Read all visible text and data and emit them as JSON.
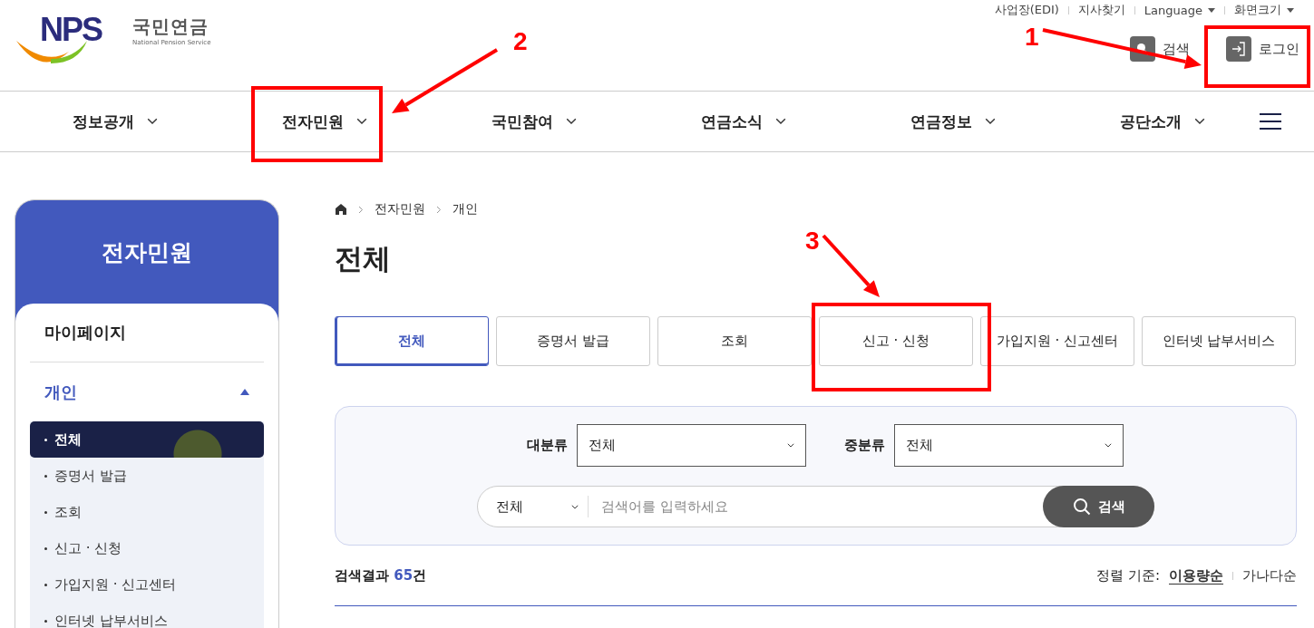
{
  "header": {
    "logo": {
      "mark": "NPS",
      "name": "국민연금",
      "subtitle": "National Pension Service"
    },
    "utility_links": [
      {
        "label": "사업장(EDI)",
        "kind": "link"
      },
      {
        "label": "지사찾기",
        "kind": "link"
      },
      {
        "label": "Language",
        "kind": "dropdown"
      },
      {
        "label": "화면크기",
        "kind": "dropdown"
      }
    ],
    "search_label": "검색",
    "login_label": "로그인"
  },
  "nav": {
    "items": [
      {
        "label": "정보공개"
      },
      {
        "label": "전자민원"
      },
      {
        "label": "국민참여"
      },
      {
        "label": "연금소식"
      },
      {
        "label": "연금정보"
      },
      {
        "label": "공단소개"
      }
    ]
  },
  "sidebar": {
    "title": "전자민원",
    "sections": [
      {
        "label": "마이페이지",
        "expanded": false
      },
      {
        "label": "개인",
        "expanded": true,
        "children": [
          {
            "label": "전체",
            "selected": true
          },
          {
            "label": "증명서 발급",
            "selected": false
          },
          {
            "label": "조회",
            "selected": false
          },
          {
            "label": "신고 · 신청",
            "selected": false
          },
          {
            "label": "가입지원 · 신고센터",
            "selected": false
          },
          {
            "label": "인터넷 납부서비스",
            "selected": false
          }
        ]
      }
    ]
  },
  "breadcrumb": [
    "전자민원",
    "개인"
  ],
  "page_title": "전체",
  "tabs": [
    {
      "label": "전체",
      "selected": true
    },
    {
      "label": "증명서 발급",
      "selected": false
    },
    {
      "label": "조회",
      "selected": false
    },
    {
      "label": "신고 · 신청",
      "selected": false
    },
    {
      "label": "가입지원 · 신고센터",
      "selected": false
    },
    {
      "label": "인터넷 납부서비스",
      "selected": false
    }
  ],
  "filters": {
    "category_label": "대분류",
    "category_value": "전체",
    "subcategory_label": "중분류",
    "subcategory_value": "전체",
    "scope_value": "전체",
    "search_placeholder": "검색어를 입력하세요",
    "search_button": "검색"
  },
  "results": {
    "label": "검색결과",
    "count": "65",
    "unit": "건",
    "sort_label": "정렬 기준:",
    "sort_options": [
      {
        "label": "이용량순",
        "selected": true
      },
      {
        "label": "가나다순",
        "selected": false
      }
    ]
  },
  "annotations": [
    {
      "number": "1"
    },
    {
      "number": "2"
    },
    {
      "number": "3"
    }
  ]
}
